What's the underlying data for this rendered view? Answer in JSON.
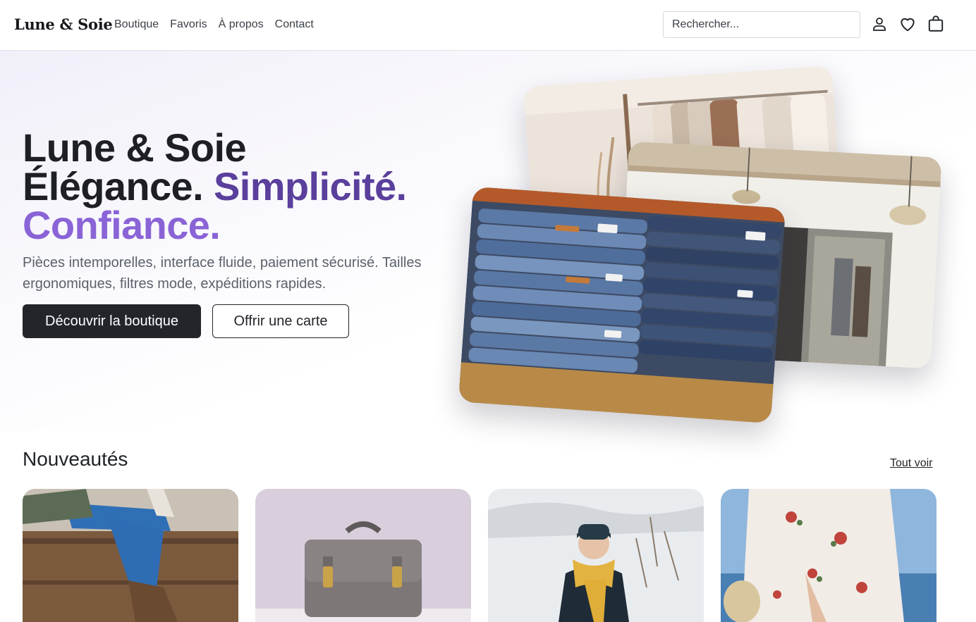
{
  "brand": "Lune & Soie",
  "nav": [
    "Boutique",
    "Favoris",
    "À propos",
    "Contact"
  ],
  "search": {
    "placeholder": "Rechercher..."
  },
  "header_icons": [
    "user-icon",
    "heart-icon",
    "shopping-bag-icon"
  ],
  "hero": {
    "title_line1": "Lune & Soie",
    "title_line2a": "Élégance.",
    "title_line2b": "Simplicité.",
    "title_line3": "Confiance.",
    "subtitle": "Pièces intemporelles, interface fluide, paiement sécurisé. Tailles ergonomiques, filtres mode, expéditions rapides.",
    "primary_cta": "Découvrir la boutique",
    "secondary_cta": "Offrir une carte",
    "photos": [
      "clothing-rack-photo",
      "boutique-interior-photo",
      "stacked-jeans-photo"
    ]
  },
  "new_arrivals": {
    "title": "Nouveautés",
    "see_all": "Tout voir",
    "products": [
      "jeans-boots-photo",
      "leather-satchel-photo",
      "yellow-scarf-photo",
      "floral-dress-photo"
    ]
  },
  "colors": {
    "accent_dark": "#22252a",
    "accent_purple": "#5a3f9c",
    "accent_violet": "#8a63d6"
  }
}
